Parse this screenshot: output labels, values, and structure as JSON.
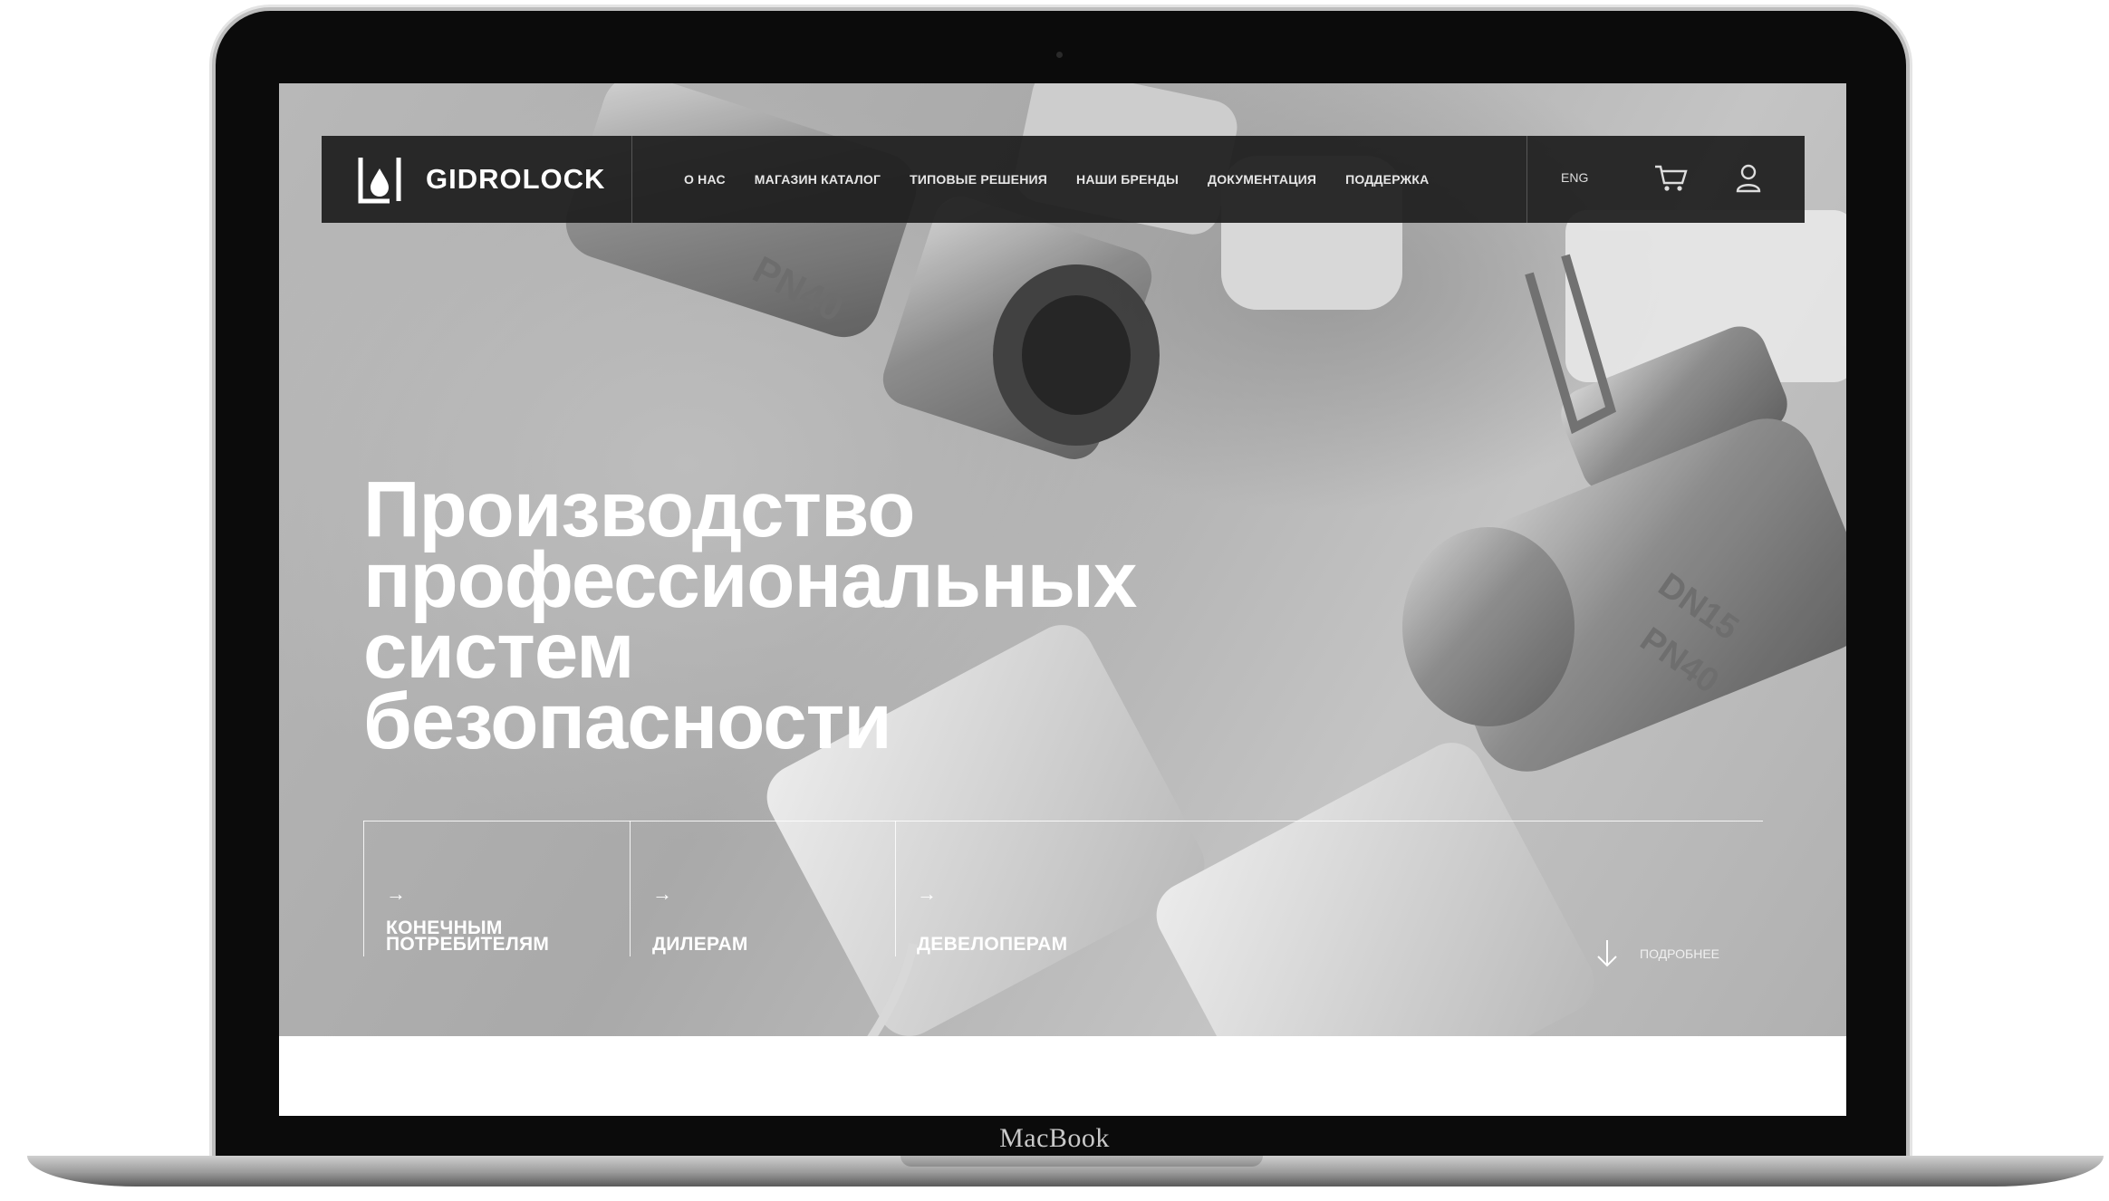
{
  "device": {
    "label": "MacBook"
  },
  "site": {
    "logo_text": "GIDROLOCK",
    "nav": {
      "items": [
        "О НАС",
        "МАГАЗИН КАТАЛОГ",
        "ТИПОВЫЕ РЕШЕНИЯ",
        "НАШИ БРЕНДЫ",
        "ДОКУМЕНТАЦИЯ",
        "ПОДДЕРЖКА"
      ],
      "lang": "ENG",
      "icons": [
        "cart-icon",
        "user-icon"
      ]
    },
    "hero": {
      "headline": [
        "Производство",
        "профессиональных",
        "систем",
        "безопасности"
      ],
      "audiences": [
        {
          "label_lines": [
            "КОНЕЧНЫМ",
            "ПОТРЕБИТЕЛЯМ"
          ]
        },
        {
          "label_lines": [
            "ДИЛЕРАМ"
          ]
        },
        {
          "label_lines": [
            "ДЕВЕЛОПЕРАМ"
          ]
        }
      ],
      "more_label": "ПОДРОБНЕЕ",
      "arrow_glyph": "→"
    },
    "colors": {
      "nav_bg": "#1c1c1c",
      "text": "#ffffff"
    }
  }
}
